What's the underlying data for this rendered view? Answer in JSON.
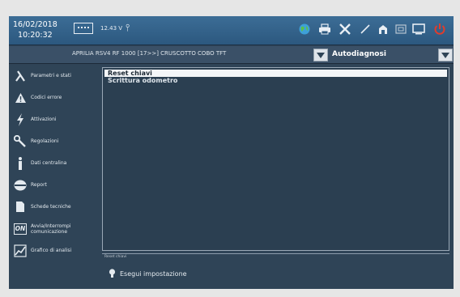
{
  "status": {
    "date": "16/02/2018",
    "time": "10:20:32",
    "voltage": "12.43 V",
    "antenna_glyph": "⫯"
  },
  "toolbar_icons": [
    "globe-icon",
    "printer-icon",
    "tools-icon",
    "pen-icon",
    "home-icon",
    "window-icon",
    "monitor-icon",
    "power-icon"
  ],
  "header": {
    "vehicle_title": "APRILIA RSV4 RF 1000 [17>>] CRUSCOTTO COBO TFT",
    "mode_label": "Autodiagnosi"
  },
  "menu": {
    "items": [
      {
        "label": "Parametri e stati",
        "icon": "lambda-icon"
      },
      {
        "label": "Codici errore",
        "icon": "warning-icon"
      },
      {
        "label": "Attivazioni",
        "icon": "lightning-icon"
      },
      {
        "label": "Regolazioni",
        "icon": "wrench-icon"
      },
      {
        "label": "Dati centralina",
        "icon": "info-icon"
      },
      {
        "label": "Report",
        "icon": "report-icon"
      },
      {
        "label": "Schede tecniche",
        "icon": "document-icon"
      },
      {
        "label": "Avvia/Interrompi\ncomunicazione",
        "icon": "on-icon",
        "icon_text": "ON"
      },
      {
        "label": "Grafico di analisi",
        "icon": "chart-icon"
      }
    ]
  },
  "list": {
    "items": [
      {
        "label": "Reset chiavi",
        "selected": true
      },
      {
        "label": "Scrittura odometro",
        "selected": false
      }
    ]
  },
  "footer": {
    "status_text": "Reset chiavi",
    "execute_label": "Esegui impostazione"
  },
  "colors": {
    "background": "#2f4457",
    "topbar": "#2c587f",
    "selected_row": "#f4f6f8",
    "power_icon": "#e03c2c"
  }
}
